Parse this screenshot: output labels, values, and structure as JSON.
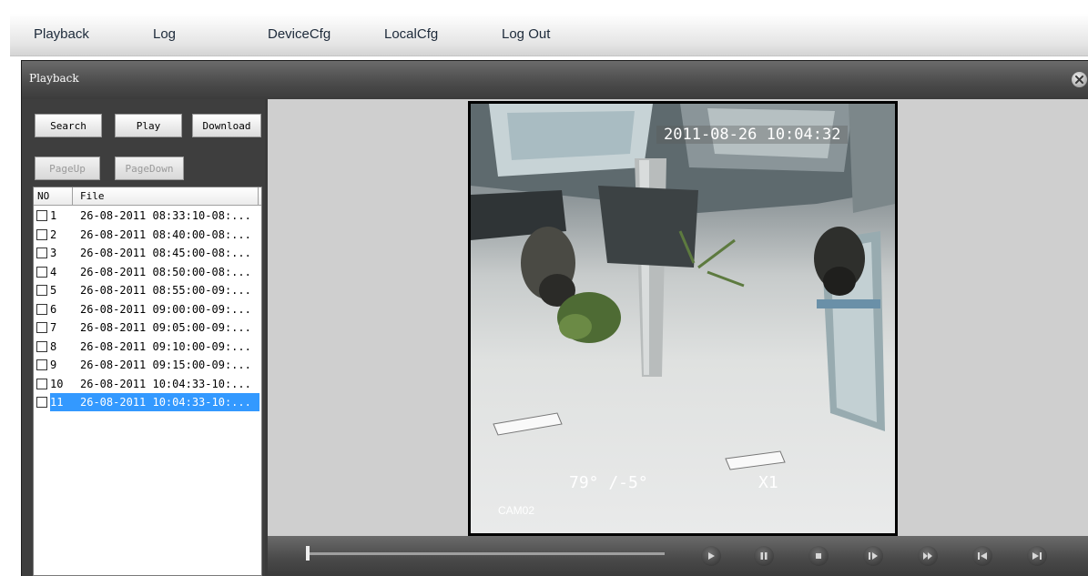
{
  "nav": {
    "items": [
      {
        "label": "Playback"
      },
      {
        "label": "Log"
      },
      {
        "label": "DeviceCfg"
      },
      {
        "label": "LocalCfg"
      },
      {
        "label": "Log Out"
      }
    ]
  },
  "window": {
    "title": "Playback"
  },
  "buttons": {
    "search": "Search",
    "play": "Play",
    "download": "Download",
    "page_up": "PageUp",
    "page_down": "PageDown"
  },
  "file_list": {
    "headers": {
      "no": "NO",
      "file": "File"
    },
    "rows": [
      {
        "no": "1",
        "file": "26-08-2011 08:33:10-08:...",
        "checked": false,
        "selected": false
      },
      {
        "no": "2",
        "file": "26-08-2011 08:40:00-08:...",
        "checked": false,
        "selected": false
      },
      {
        "no": "3",
        "file": "26-08-2011 08:45:00-08:...",
        "checked": false,
        "selected": false
      },
      {
        "no": "4",
        "file": "26-08-2011 08:50:00-08:...",
        "checked": false,
        "selected": false
      },
      {
        "no": "5",
        "file": "26-08-2011 08:55:00-09:...",
        "checked": false,
        "selected": false
      },
      {
        "no": "6",
        "file": "26-08-2011 09:00:00-09:...",
        "checked": false,
        "selected": false
      },
      {
        "no": "7",
        "file": "26-08-2011 09:05:00-09:...",
        "checked": false,
        "selected": false
      },
      {
        "no": "8",
        "file": "26-08-2011 09:10:00-09:...",
        "checked": false,
        "selected": false
      },
      {
        "no": "9",
        "file": "26-08-2011 09:15:00-09:...",
        "checked": false,
        "selected": false
      },
      {
        "no": "10",
        "file": "26-08-2011 10:04:33-10:...",
        "checked": false,
        "selected": false
      },
      {
        "no": "11",
        "file": "26-08-2011 10:04:33-10:...",
        "checked": false,
        "selected": true
      }
    ]
  },
  "video": {
    "timestamp": "2011-08-26 10:04:32",
    "ptz": "79° /-5°",
    "zoom": "X1",
    "camera": "CAM02"
  },
  "controls": {
    "progress": 0.0,
    "icons": [
      "play-icon",
      "pause-icon",
      "stop-icon",
      "step-forward-icon",
      "fast-forward-icon",
      "previous-file-icon",
      "next-file-icon"
    ]
  },
  "colors": {
    "selection": "#3399ff",
    "window_bg": "#3e3e3e",
    "video_area_bg": "#cfcfcf"
  }
}
